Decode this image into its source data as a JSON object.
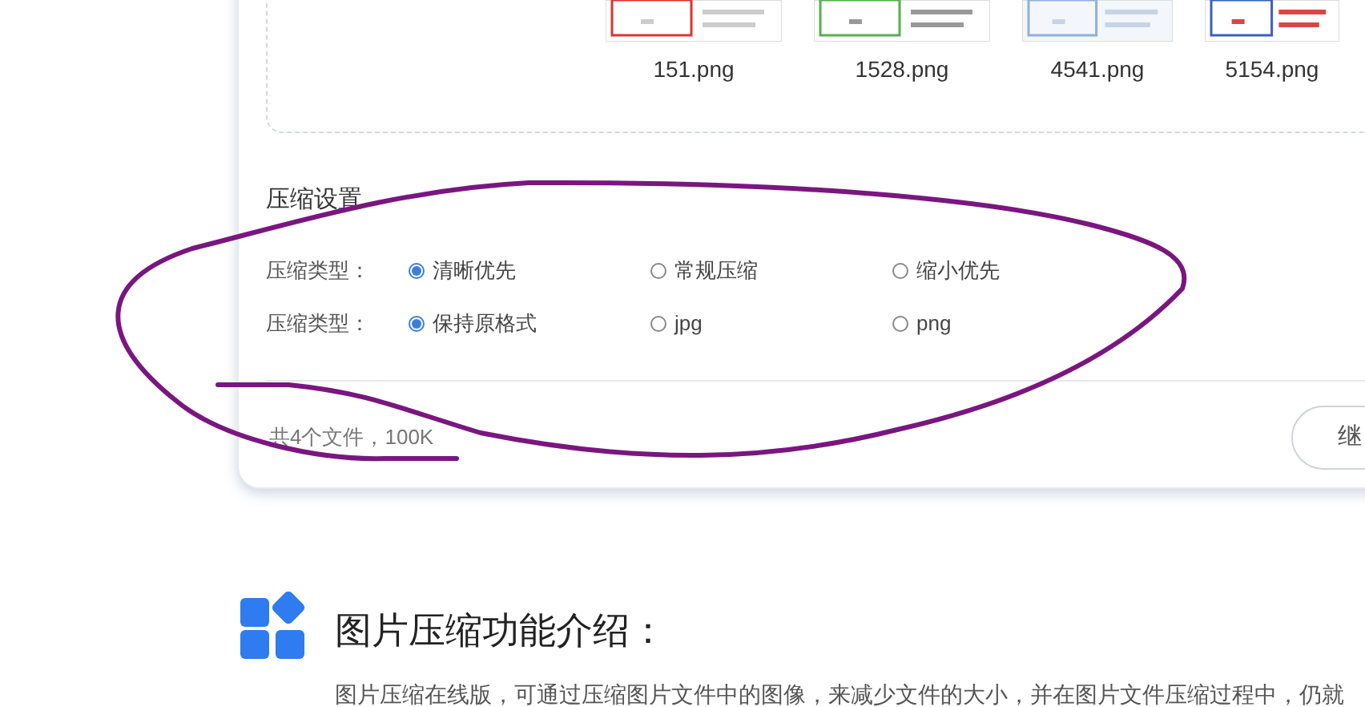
{
  "files": [
    {
      "name": "151.png",
      "kind": "picture"
    },
    {
      "name": "1528.png",
      "kind": "picture"
    },
    {
      "name": "4541.png",
      "kind": "picture"
    },
    {
      "name": "5154.png",
      "kind": "picture"
    }
  ],
  "settings": {
    "title": "压缩设置",
    "groups": [
      {
        "label": "压缩类型：",
        "options": [
          {
            "label": "清晰优先",
            "selected": true
          },
          {
            "label": "常规压缩",
            "selected": false
          },
          {
            "label": "缩小优先",
            "selected": false
          }
        ]
      },
      {
        "label": "压缩类型：",
        "options": [
          {
            "label": "保持原格式",
            "selected": true
          },
          {
            "label": "jpg",
            "selected": false
          },
          {
            "label": "png",
            "selected": false
          }
        ]
      }
    ]
  },
  "footer": {
    "summary": "共4个文件，100K",
    "button": "继"
  },
  "intro": {
    "title": "图片压缩功能介绍：",
    "text": "图片压缩在线版，可通过压缩图片文件中的图像，来减少文件的大小，并在图片文件压缩过程中，仍就"
  }
}
